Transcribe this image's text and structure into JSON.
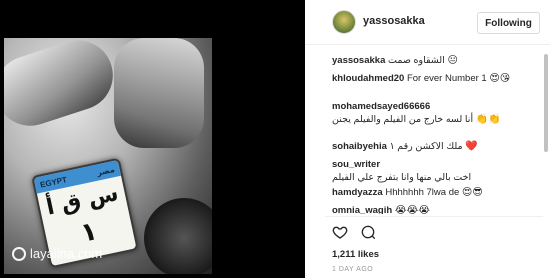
{
  "media": {
    "plate": {
      "band_left": "EGYPT",
      "band_right": "مصر",
      "letters": "س ق أ",
      "number": "١"
    },
    "watermark": "layalina.com"
  },
  "header": {
    "username": "yassosakka",
    "follow_label": "Following"
  },
  "comments": [
    {
      "user": "yassosakka",
      "text": "الشقاوه صمت",
      "emoji": "😐"
    },
    {
      "user": "khloudahmed20",
      "text": "For ever Number 1",
      "emoji": "😍😘"
    },
    {
      "user": "mohamedsayed66666",
      "text": "أنا لسه خارج من الفيلم والفيلم يجنن",
      "emoji": "👏👏"
    },
    {
      "user": "sohaibyehia",
      "text": "ملك الاكشن رقم ١",
      "emoji": "❤️"
    },
    {
      "user": "sou_writer",
      "text": "اخت بالي منها وانا بتفرج علي الفيلم",
      "emoji": ""
    },
    {
      "user": "hamdyazza",
      "text": "Hhhhhhh 7lwa de",
      "emoji": "😍😎"
    },
    {
      "user": "omnia_wagih",
      "text": "",
      "emoji": "😭😭😭"
    }
  ],
  "likes": "1,211 likes",
  "time": "1 DAY AGO",
  "icons": [
    "heart-icon",
    "comment-bubble-icon"
  ],
  "colors": {
    "plate_band": "#3f8fd0",
    "text": "#262626",
    "muted": "#999999"
  }
}
